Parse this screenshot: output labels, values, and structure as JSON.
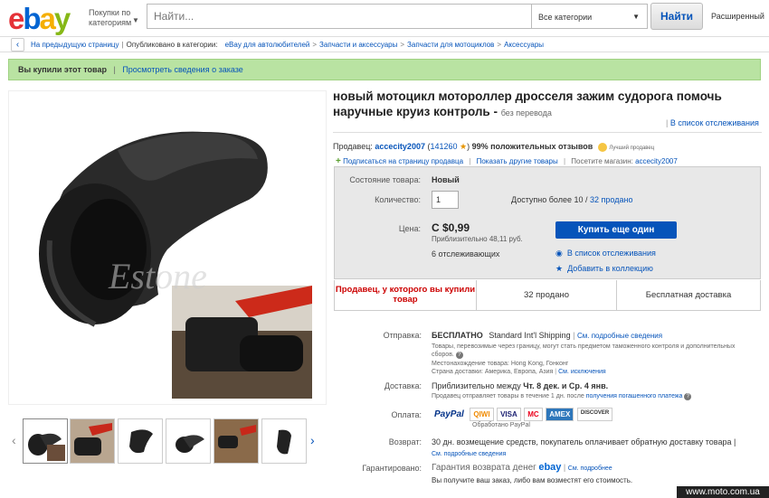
{
  "header": {
    "logo": [
      "e",
      "b",
      "a",
      "y"
    ],
    "shop_by_category": "Покупки по категориям",
    "search_placeholder": "Найти...",
    "category_select": "Все категории",
    "search_button": "Найти",
    "advanced": "Расширенный"
  },
  "breadcrumb": {
    "back_label": "На предыдущую страницу",
    "listed_in": "Опубликовано в категории:",
    "items": [
      "eBay для автолюбителей",
      "Запчасти и аксессуары",
      "Запчасти для мотоциклов",
      "Аксессуары"
    ]
  },
  "banner": {
    "bought": "Вы купили этот товар",
    "view_order": "Просмотреть сведения о заказе"
  },
  "title": {
    "text": "новый мотоцикл мотороллер дросселя зажим судорога помочь наручные круиз контроль -",
    "no_translation": "без перевода",
    "watchlist_link": "В список отслеживания"
  },
  "seller": {
    "label": "Продавец:",
    "name": "accecity2007",
    "score": "141260",
    "positive": "99% положительных отзывов",
    "badge_text": "Лучший продавец",
    "subscribe": "Подписаться на страницу продавца",
    "other_items": "Показать другие товары",
    "visit_store_label": "Посетите магазин:",
    "store": "accecity2007"
  },
  "item": {
    "condition_label": "Состояние товара:",
    "condition": "Новый",
    "qty_label": "Количество:",
    "qty": "1",
    "available_prefix": "Доступно более 10 /",
    "sold_link": "32 продано",
    "price_label": "Цена:",
    "price": "C $0,99",
    "approx": "Приблизительно 48,11 руб.",
    "watchers": "6 отслеживающих",
    "buy_again": "Купить еще один",
    "add_watch": "В список отслеживания",
    "add_collection": "Добавить в коллекцию"
  },
  "stats": {
    "repeat_seller": "Продавец, у которого вы купили товар",
    "sold": "32 продано",
    "free_shipping": "Бесплатная доставка"
  },
  "shipping": {
    "label": "Отправка:",
    "free": "БЕСПЛАТНО",
    "method": "Standard Int'l Shipping",
    "details_link": "См. подробные сведения",
    "customs_note": "Товары, перевозимые через границу, могут стать предметом таможенного контроля и дополнительных сборов.",
    "location": "Местонахождение товара:  Hong Kong, Гонконг",
    "ships_to": "Страна доставки:  Америка, Европа, Азия",
    "exclusions_link": "См. исключения"
  },
  "delivery": {
    "label": "Доставка:",
    "text_prefix": "Приблизительно между",
    "dates": "Чт. 8 дек. и Ср. 4 янв.",
    "note": "Продавец отправляет товары в течение 1 дн. после",
    "note_link": "получения погашенного платежа"
  },
  "payment": {
    "label": "Оплата:",
    "methods": [
      "PayPal",
      "QIWI",
      "VISA",
      "MC",
      "AMEX",
      "DISCOVER"
    ],
    "processed_by": "Обработано PayPal"
  },
  "returns": {
    "label": "Возврат:",
    "text": "30 дн. возмещение средств, покупатель оплачивает обратную доставку товара |",
    "details_link": "См. подробные сведения"
  },
  "guarantee": {
    "label": "Гарантировано:",
    "text": "Гарантия возврата денег",
    "brand": "ebay",
    "details_link": "См. подробнее",
    "note": "Вы получите ваш заказ, либо вам возместят его стоимость."
  },
  "watermark": "www.moto.com.ua",
  "colors": {
    "link": "#0654ba",
    "banner_bg": "#b9e3a2",
    "buy_button": "#0654ba",
    "alert_red": "#cc0000"
  }
}
